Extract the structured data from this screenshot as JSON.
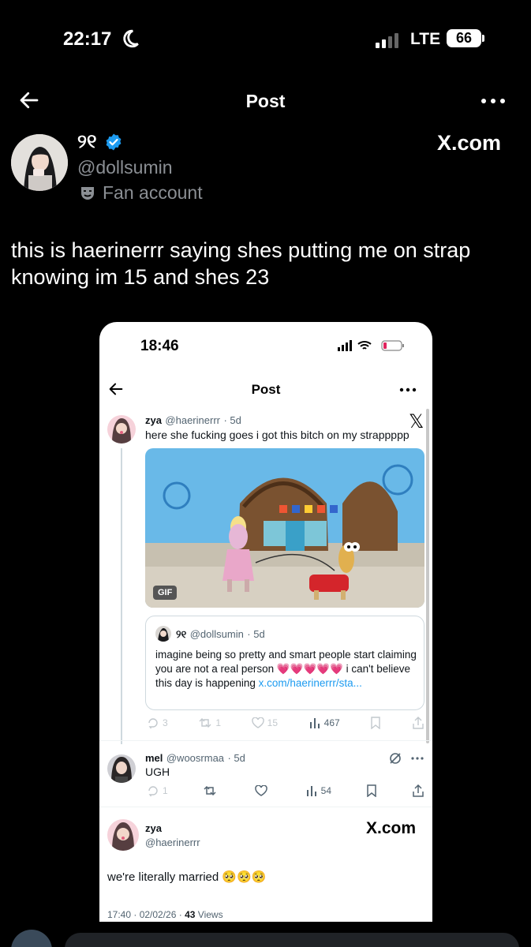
{
  "status_bar": {
    "time": "22:17",
    "network": "LTE",
    "battery": "66"
  },
  "header": {
    "title": "Post"
  },
  "author": {
    "name": "୨୧",
    "handle": "@dollsumin",
    "label": "Fan account"
  },
  "watermark": "X.com",
  "tweet": {
    "text": "this is haerinerrr saying shes putting me on strap knowing im 15 and shes 23"
  },
  "embedded": {
    "status_bar": {
      "time": "18:46"
    },
    "header": {
      "title": "Post"
    },
    "post1": {
      "name": "zya",
      "handle": "@haerinerrr",
      "age": "· 5d",
      "text": "here she fucking goes i got this bitch on my strappppp",
      "gif_label": "GIF",
      "quote": {
        "name": "୨୧",
        "handle": "@dollsumin",
        "age": "· 5d",
        "text": "imagine being so pretty and smart people start claiming you are not a real person 💗💗💗💗💗 i can't believe this day is happening ",
        "link": "x.com/haerinerrr/sta..."
      },
      "actions": {
        "replies": "3",
        "reposts": "1",
        "likes": "15",
        "views": "467"
      }
    },
    "post2": {
      "name": "mel",
      "handle": "@woosrmaa",
      "age": "· 5d",
      "text": "UGH",
      "actions": {
        "replies": "1",
        "reposts": "",
        "likes": "",
        "views": "54"
      }
    },
    "post3": {
      "name": "zya",
      "handle": "@haerinerrr",
      "watermark": "X.com",
      "text": "we're literally married 🥺🥺🥺",
      "time": "17:40 · 02/02/26 · ",
      "views_count": "43",
      "views_label": "Views"
    }
  },
  "colors": {
    "background": "#000000",
    "accent": "#1d9bf0",
    "muted": "#8b8f94"
  }
}
